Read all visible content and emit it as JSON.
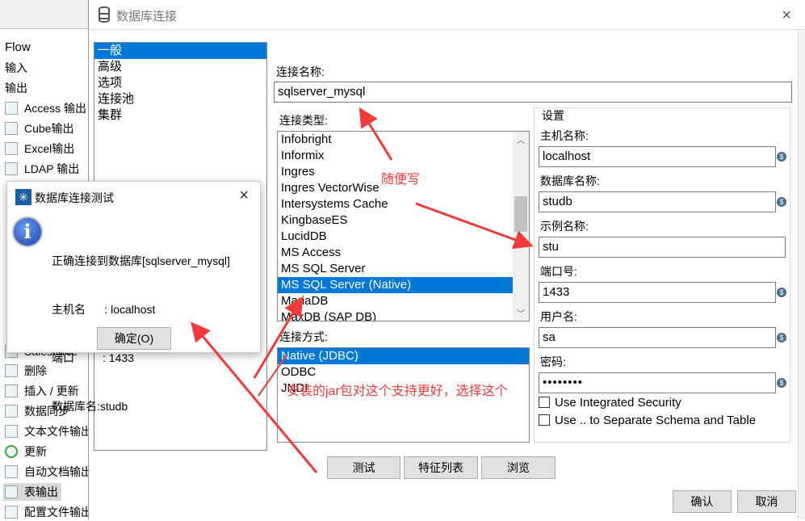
{
  "sidebar": {
    "items": [
      "Flow",
      "输入",
      "输出",
      "Access 输出",
      "Cube输出",
      "Excel输出",
      "LDAP 输出",
      "Salesforce",
      "删除",
      "插入 / 更新",
      "数据同步",
      "文本文件输出",
      "更新",
      "自动文档输出",
      "表输出",
      "配置文件输出"
    ],
    "selected": "表输出"
  },
  "dialog": {
    "title": "数据库连接",
    "close": "×",
    "tree": [
      "一般",
      "高级",
      "选项",
      "连接池",
      "集群"
    ],
    "tree_selected": "一般",
    "conn_name_label": "连接名称:",
    "conn_name": "sqlserver_mysql",
    "conn_type_label": "连接类型:",
    "conn_types": [
      "Infobright",
      "Informix",
      "Ingres",
      "Ingres VectorWise",
      "Intersystems Cache",
      "KingbaseES",
      "LucidDB",
      "MS Access",
      "MS SQL Server",
      "MS SQL Server (Native)",
      "MariaDB",
      "MaxDB (SAP DB)"
    ],
    "conn_type_selected": "MS SQL Server (Native)",
    "access_label": "连接方式:",
    "access_types": [
      "Native (JDBC)",
      "ODBC",
      "JNDI"
    ],
    "access_selected": "Native (JDBC)",
    "settings": {
      "title": "设置",
      "host_label": "主机名称:",
      "host": "localhost",
      "db_label": "数据库名称:",
      "db": "studb",
      "instance_label": "示例名称:",
      "instance": "stu",
      "port_label": "端口号:",
      "port": "1433",
      "user_label": "用户名:",
      "user": "sa",
      "pass_label": "密码:",
      "pass": "••••••••",
      "integrated": "Use Integrated Security",
      "separate": "Use .. to Separate Schema and Table"
    },
    "buttons": {
      "test": "测试",
      "features": "特征列表",
      "explore": "浏览",
      "ok": "确认",
      "cancel": "取消"
    }
  },
  "popup": {
    "title": "数据库连接测试",
    "close": "×",
    "lines": [
      "正确连接到数据库[sqlserver_mysql]",
      "主机名      : localhost",
      "端口         : 1433",
      "数据库名:studb"
    ],
    "ok": "确定(O)"
  },
  "annotations": {
    "name_note": "随便写",
    "jar_note": "安装的jar包对这个支持更好，选择这个"
  },
  "colors": {
    "selection": "#0078d7",
    "annotation": "#f23a3a"
  }
}
